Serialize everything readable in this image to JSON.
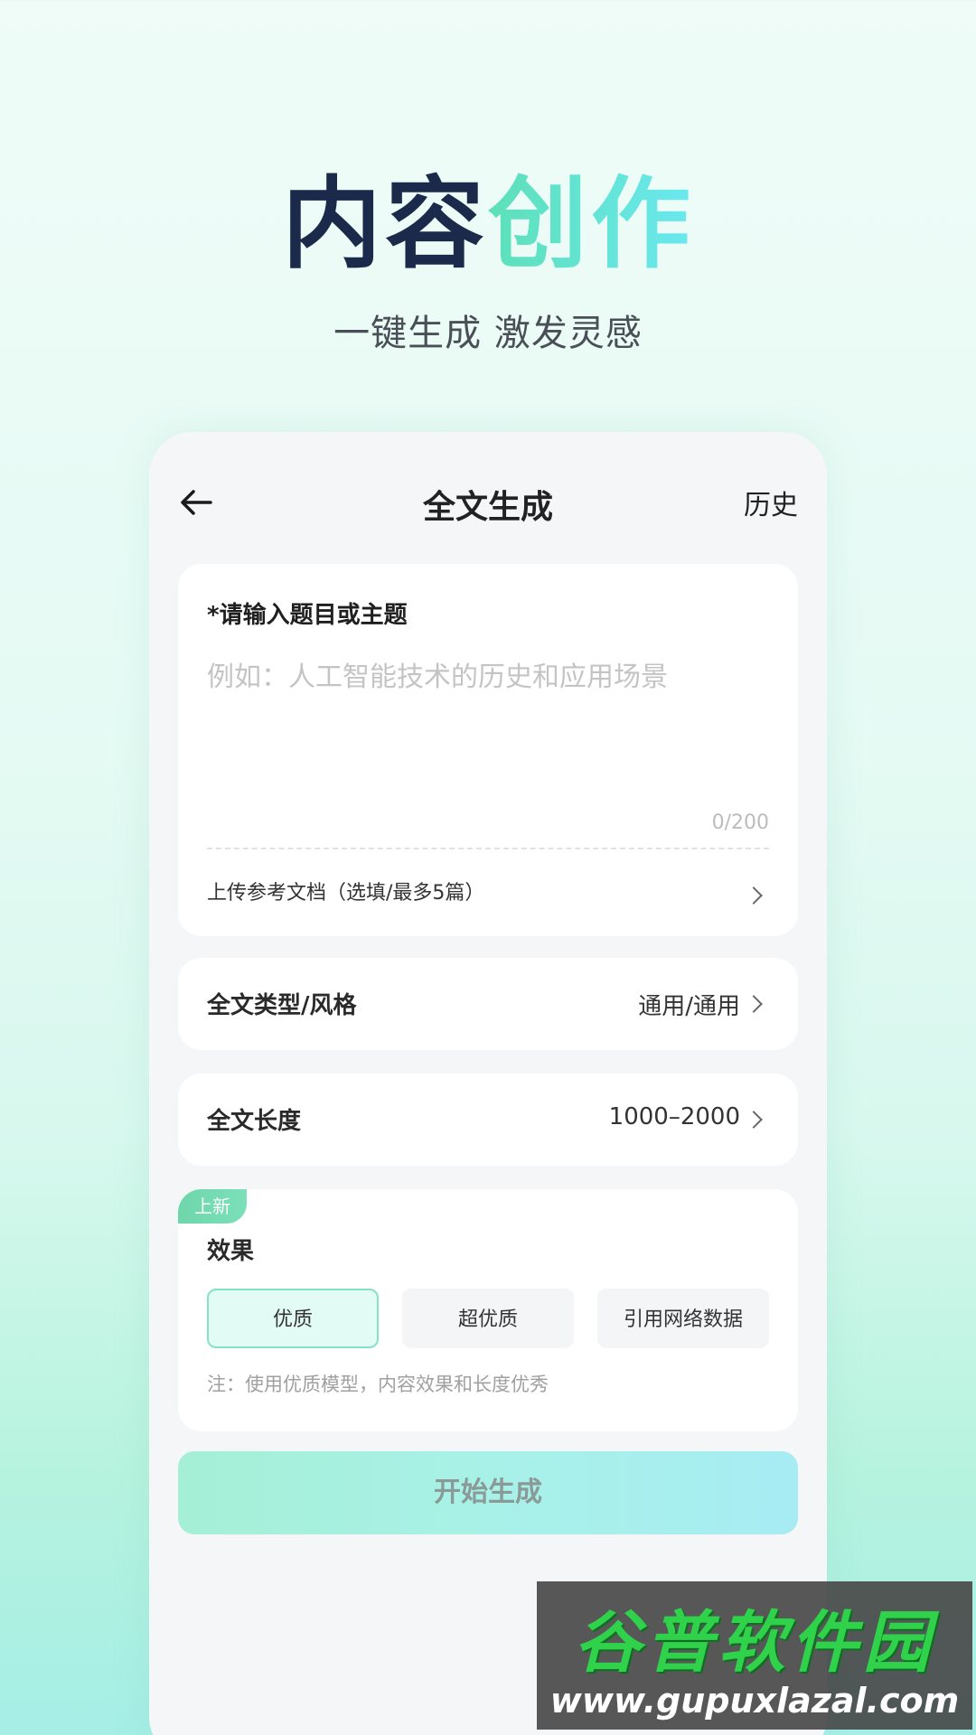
{
  "hero": {
    "title_dark": "内容",
    "title_accent": "创作",
    "subtitle": "一键生成 激发灵感"
  },
  "header": {
    "back_icon": "arrow-left-icon",
    "title": "全文生成",
    "history_label": "历史"
  },
  "topic": {
    "label": "*请输入题目或主题",
    "placeholder": "例如：人工智能技术的历史和应用场景",
    "value": "",
    "counter": "0/200",
    "upload_label": "上传参考文档（选填/最多5篇）"
  },
  "settings": {
    "type_label": "全文类型/风格",
    "type_value": "通用/通用",
    "length_label": "全文长度",
    "length_value": "1000–2000"
  },
  "effect": {
    "badge": "上新",
    "label": "效果",
    "options": [
      "优质",
      "超优质",
      "引用网络数据"
    ],
    "selected": "优质",
    "note": "注：使用优质模型，内容效果和长度优秀"
  },
  "actions": {
    "start_label": "开始生成"
  },
  "watermark": {
    "logo_text": "谷普软件园",
    "url": "www.gupuxlazal.com"
  },
  "colors": {
    "accent": "#5fe3d0",
    "dark_title": "#1b2a4a",
    "selected_border": "#86e2c6",
    "badge": "#6fd6ab"
  }
}
